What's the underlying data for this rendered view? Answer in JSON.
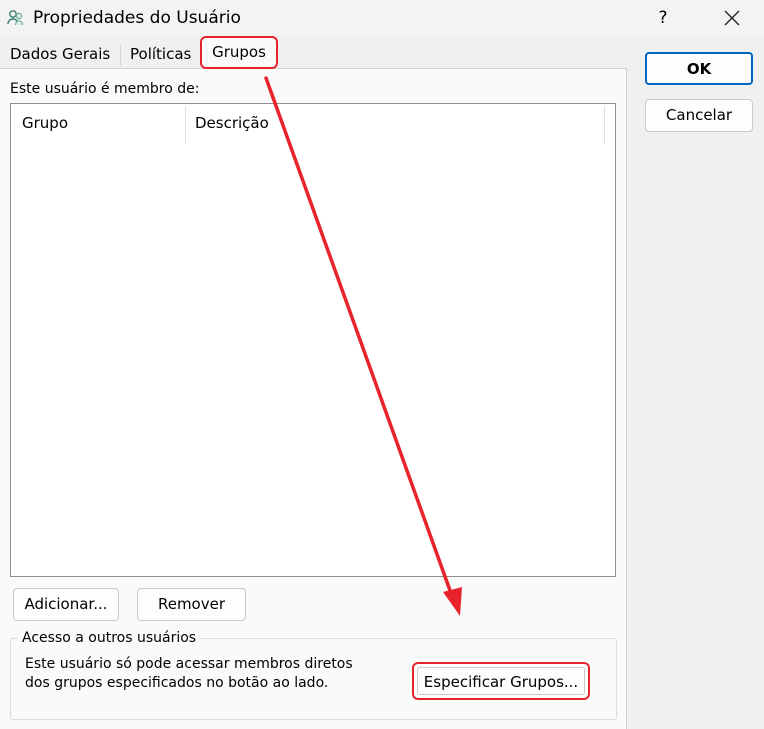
{
  "window": {
    "title": "Propriedades do Usuário",
    "help_label": "?",
    "close_icon": "close-icon",
    "title_icon": "user-properties-icon"
  },
  "tabs": [
    {
      "label": "Dados Gerais",
      "selected": false
    },
    {
      "label": "Políticas",
      "selected": false
    },
    {
      "label": "Grupos",
      "selected": true
    }
  ],
  "members": {
    "label": "Este usuário é membro de:",
    "columns": [
      "Grupo",
      "Descrição"
    ],
    "rows": []
  },
  "buttons": {
    "ok": "OK",
    "cancel": "Cancelar",
    "add": "Adicionar...",
    "remove": "Remover"
  },
  "access": {
    "title": "Acesso a outros usuários",
    "description": "Este usuário só pode acessar membros diretos dos grupos especificados no botão ao lado.",
    "button": "Especificar Grupos..."
  },
  "annotation": {
    "color": "#e8232b"
  }
}
